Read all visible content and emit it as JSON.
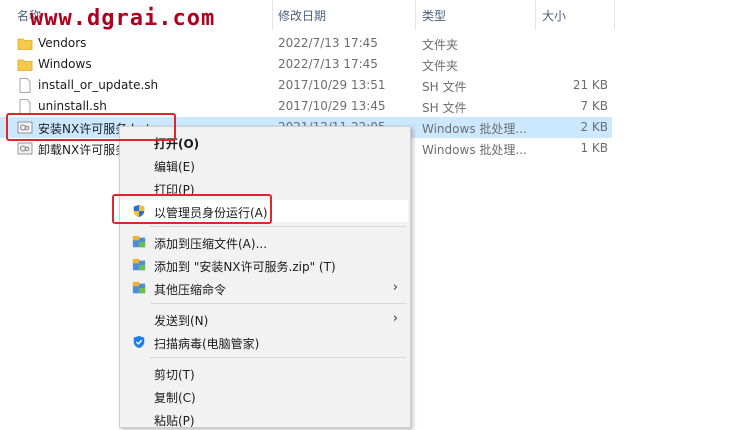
{
  "header": {
    "name": "名称",
    "date": "修改日期",
    "type": "类型",
    "size": "大小",
    "watermark": "www.dgrai.com"
  },
  "files": [
    {
      "name": "Vendors",
      "date": "2022/7/13 17:45",
      "type": "文件夹",
      "size": "",
      "icon": "folder-icon"
    },
    {
      "name": "Windows",
      "date": "2022/7/13 17:45",
      "type": "文件夹",
      "size": "",
      "icon": "folder-icon"
    },
    {
      "name": "install_or_update.sh",
      "date": "2017/10/29 13:51",
      "type": "SH 文件",
      "size": "21 KB",
      "icon": "file-icon"
    },
    {
      "name": "uninstall.sh",
      "date": "2017/10/29 13:45",
      "type": "SH 文件",
      "size": "7 KB",
      "icon": "file-icon"
    },
    {
      "name": "安装NX许可服务.bat",
      "date": "2021/12/11 22:05",
      "type": "Windows 批处理...",
      "size": "2 KB",
      "icon": "batch-file-icon"
    },
    {
      "name": "卸载NX许可服务.bat",
      "date": "",
      "type": "Windows 批处理...",
      "size": "1 KB",
      "icon": "batch-file-icon"
    }
  ],
  "context_menu": {
    "open": "打开(O)",
    "edit": "编辑(E)",
    "print": "打印(P)",
    "run_as_admin": "以管理员身份运行(A)",
    "add_to_archive": "添加到压缩文件(A)...",
    "add_to_zip": "添加到 \"安装NX许可服务.zip\" (T)",
    "other_compress": "其他压缩命令",
    "send_to": "发送到(N)",
    "scan_virus": "扫描病毒(电脑管家)",
    "cut": "剪切(T)",
    "copy": "复制(C)",
    "paste": "粘贴(P)"
  },
  "colors": {
    "selection": "#cce8ff",
    "highlight_box": "#e0262d",
    "watermark": "#b0001e"
  }
}
